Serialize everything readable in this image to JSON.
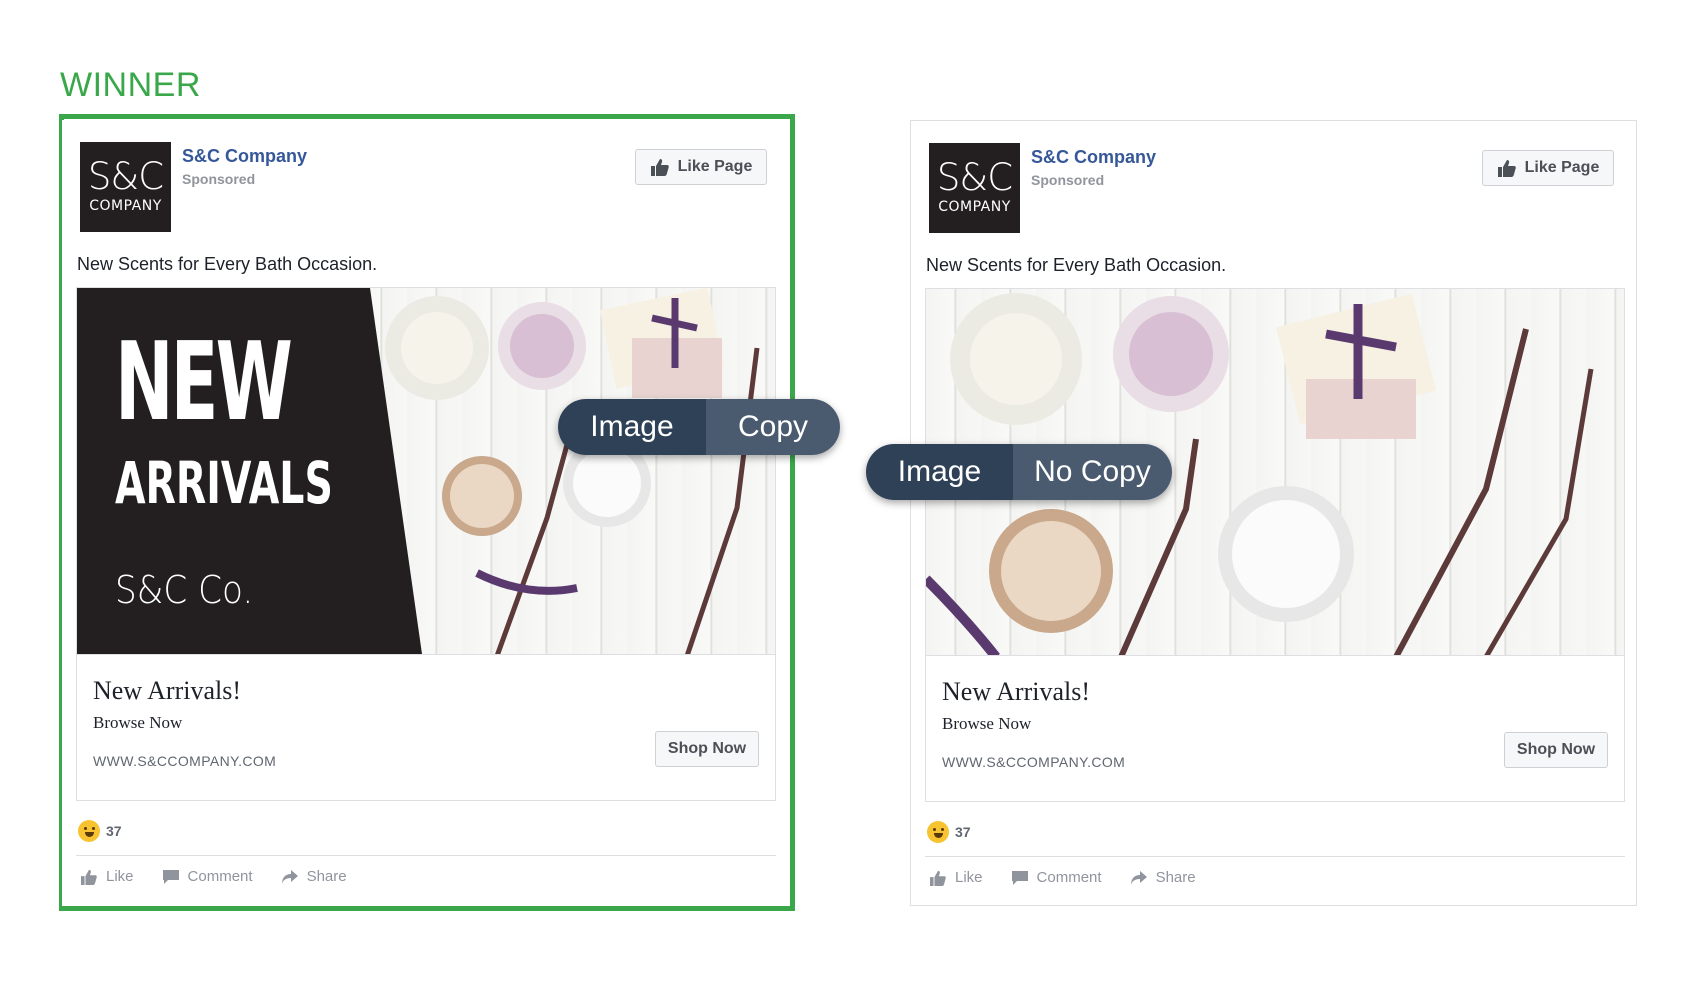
{
  "winner_label": "WINNER",
  "cards": [
    {
      "page_name": "S&C Company",
      "sponsored": "Sponsored",
      "logo_main": "S&C",
      "logo_sub": "COMPANY",
      "like_page": "Like Page",
      "post_text": "New Scents for Every Bath Occasion.",
      "overlay": {
        "line1": "NEW",
        "line2": "ARRIVALS",
        "line3": "S&C Co."
      },
      "headline": "New Arrivals!",
      "description": "Browse Now",
      "url": "WWW.S&CCOMPANY.COM",
      "cta": "Shop Now",
      "reaction_count": "37",
      "actions": {
        "like": "Like",
        "comment": "Comment",
        "share": "Share"
      }
    },
    {
      "page_name": "S&C Company",
      "sponsored": "Sponsored",
      "logo_main": "S&C",
      "logo_sub": "COMPANY",
      "like_page": "Like Page",
      "post_text": "New Scents for Every Bath Occasion.",
      "headline": "New Arrivals!",
      "description": "Browse Now",
      "url": "WWW.S&CCOMPANY.COM",
      "cta": "Shop Now",
      "reaction_count": "37",
      "actions": {
        "like": "Like",
        "comment": "Comment",
        "share": "Share"
      }
    }
  ],
  "pills": [
    {
      "left": "Image",
      "right": "Copy"
    },
    {
      "left": "Image",
      "right": "No Copy"
    }
  ],
  "colors": {
    "winner": "#3aa84a",
    "link": "#365899",
    "pill_dark": "#2f4157",
    "pill_light": "#4a5b6f"
  }
}
